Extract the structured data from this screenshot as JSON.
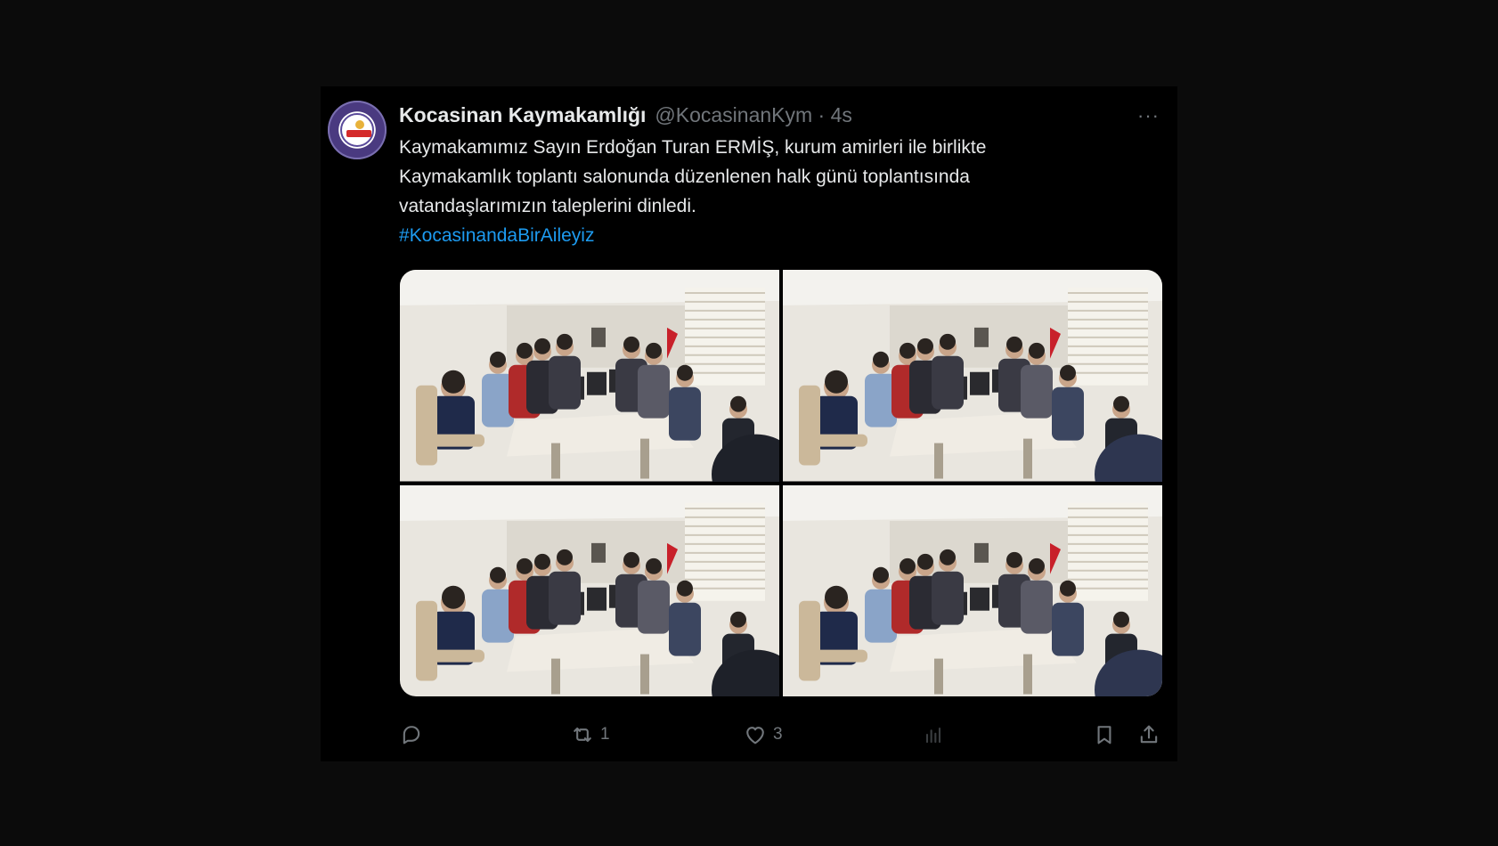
{
  "tweet": {
    "author_name": "Kocasinan Kaymakamlığı",
    "handle_and_time": "@KocasinanKym · 4s",
    "more_label": "···",
    "text_line1": "Kaymakamımız Sayın Erdoğan Turan ERMİŞ, kurum amirleri ile birlikte",
    "text_line2": "Kaymakamlık toplantı salonunda düzenlenen halk günü toplantısında",
    "text_line3": "vatandaşlarımızın taleplerini dinledi.",
    "hashtag": "#KocasinandaBirAileyiz",
    "photos": [
      {
        "description_icon": "meeting-photo"
      },
      {
        "description_icon": "meeting-photo"
      },
      {
        "description_icon": "meeting-photo"
      },
      {
        "description_icon": "meeting-photo"
      }
    ]
  },
  "actions": {
    "reply_count": "",
    "retweet_count": "1",
    "like_count": "3",
    "views_count": ""
  },
  "colors": {
    "background": "#0b0b0b",
    "card": "#000000",
    "text": "#e7e9ea",
    "muted": "#71767b",
    "link": "#1d9bf0"
  }
}
